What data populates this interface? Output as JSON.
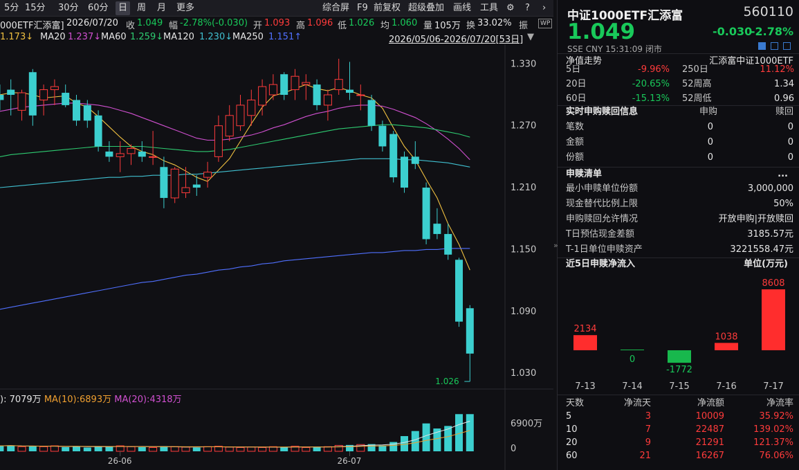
{
  "toolbar": {
    "periods": [
      "5分",
      "15分",
      "30分",
      "60分",
      "日",
      "周",
      "月",
      "更多"
    ],
    "active_period": "日",
    "tools": [
      "综合屏",
      "F9",
      "前复权",
      "超级叠加",
      "画线",
      "工具"
    ],
    "settings_icon": "gear-icon",
    "help_icon": "question-icon",
    "collapse_icon": "chevron-right-icon"
  },
  "info": {
    "name": "000ETF汇添富]",
    "date": "2026/07/20",
    "close_label": "收",
    "close": "1.049",
    "chg_label": "幅",
    "chg": "-2.78%(-0.030)",
    "open_label": "开",
    "open": "1.093",
    "high_label": "高",
    "high": "1.096",
    "low_label": "低",
    "low": "1.026",
    "avg_label": "均",
    "avg": "1.060",
    "vol_label": "量",
    "vol": "105万",
    "turn_label": "换",
    "turn": "33.02%",
    "amp_label": "振",
    "wp_badge": "WP"
  },
  "ma": {
    "ma5_val": "1.173↓",
    "ma20_label": "MA20",
    "ma20_val": "1.237↓",
    "ma60_label": "MA60",
    "ma60_val": "1.259↓",
    "ma120_label": "MA120",
    "ma120_val": "1.230↓",
    "ma250_label": "MA250",
    "ma250_val": "1.151↑",
    "range": "2026/05/06-2026/07/20[53日]",
    "range_dropdown_icon": "triangle-down-icon"
  },
  "price_axis": [
    "1.330",
    "1.270",
    "1.210",
    "1.150",
    "1.090",
    "1.030"
  ],
  "low_marker": "1.026",
  "volume": {
    "ma5_val": "7079万",
    "ma10_label": "MA(10):",
    "ma10_val": "6893万",
    "ma20_label": "MA(20):",
    "ma20_val": "4318万",
    "axis_top": "6900万",
    "axis_zero": "0",
    "dates": [
      "26-06",
      "26-07"
    ],
    "handle_icon": "double-chevron-right-icon"
  },
  "right": {
    "title": "中证1000ETF汇添富",
    "code": "560110",
    "price": "1.049",
    "chg": "-0.030",
    "chg_pct": "-2.78%",
    "market": "SSE  CNY  15:31:09  闭市",
    "nav_label": "净值走势",
    "nav_name": "汇添富中证1000ETF",
    "perf": [
      {
        "p": "5日",
        "v": "-9.96%",
        "p2": "250日",
        "v2": "11.12%"
      },
      {
        "p": "20日",
        "v": "-20.65%",
        "p2": "52周高",
        "v2": "1.34"
      },
      {
        "p": "60日",
        "v": "-15.13%",
        "p2": "52周低",
        "v2": "0.96"
      }
    ],
    "rt_title": "实时申购赎回信息",
    "rt_col1": "申购",
    "rt_col2": "赎回",
    "rt_rows": [
      {
        "k": "笔数",
        "a": "0",
        "b": "0"
      },
      {
        "k": "金额",
        "a": "0",
        "b": "0"
      },
      {
        "k": "份额",
        "a": "0",
        "b": "0"
      }
    ],
    "list_title": "申赎清单",
    "list_more": "...",
    "list_rows": [
      {
        "k": "最小申赎单位份额",
        "v": "3,000,000"
      },
      {
        "k": "现金替代比例上限",
        "v": "50%"
      },
      {
        "k": "申购赎回允许情况",
        "v": "开放申购|开放赎回"
      },
      {
        "k": "T日预估现金差额",
        "v": "3185.57元"
      },
      {
        "k": "T-1日单位申赎资产",
        "v": "3221558.47元"
      }
    ],
    "flow_title": "近5日申赎净流入",
    "flow_unit": "单位(万元)",
    "stats_headers": [
      "天数",
      "净流天",
      "净流额",
      "净流率"
    ],
    "stats": [
      {
        "d": "5",
        "n": "3",
        "amt": "10009",
        "rate": "35.92%"
      },
      {
        "d": "10",
        "n": "7",
        "amt": "22487",
        "rate": "139.02%"
      },
      {
        "d": "20",
        "n": "9",
        "amt": "21291",
        "rate": "121.37%"
      },
      {
        "d": "60",
        "n": "21",
        "amt": "16267",
        "rate": "76.06%"
      }
    ]
  },
  "chart_data": [
    {
      "type": "candlestick",
      "title": "",
      "ylim": [
        1.02,
        1.345
      ],
      "y_ticks": [
        1.33,
        1.27,
        1.21,
        1.15,
        1.09,
        1.03
      ],
      "x_ticks": [
        "26-06",
        "26-07"
      ],
      "candles": [
        {
          "o": 1.3,
          "h": 1.31,
          "l": 1.285,
          "c": 1.295
        },
        {
          "o": 1.305,
          "h": 1.315,
          "l": 1.28,
          "c": 1.3
        },
        {
          "o": 1.285,
          "h": 1.305,
          "l": 1.275,
          "c": 1.302
        },
        {
          "o": 1.322,
          "h": 1.325,
          "l": 1.27,
          "c": 1.28
        },
        {
          "o": 1.295,
          "h": 1.31,
          "l": 1.28,
          "c": 1.305
        },
        {
          "o": 1.305,
          "h": 1.315,
          "l": 1.29,
          "c": 1.308
        },
        {
          "o": 1.302,
          "h": 1.31,
          "l": 1.288,
          "c": 1.29
        },
        {
          "o": 1.295,
          "h": 1.3,
          "l": 1.27,
          "c": 1.275
        },
        {
          "o": 1.29,
          "h": 1.295,
          "l": 1.268,
          "c": 1.275
        },
        {
          "o": 1.28,
          "h": 1.285,
          "l": 1.245,
          "c": 1.25
        },
        {
          "o": 1.245,
          "h": 1.255,
          "l": 1.235,
          "c": 1.24
        },
        {
          "o": 1.24,
          "h": 1.255,
          "l": 1.225,
          "c": 1.243
        },
        {
          "o": 1.243,
          "h": 1.252,
          "l": 1.232,
          "c": 1.248
        },
        {
          "o": 1.245,
          "h": 1.255,
          "l": 1.235,
          "c": 1.24
        },
        {
          "o": 1.24,
          "h": 1.265,
          "l": 1.232,
          "c": 1.24
        },
        {
          "o": 1.23,
          "h": 1.24,
          "l": 1.19,
          "c": 1.2
        },
        {
          "o": 1.2,
          "h": 1.23,
          "l": 1.195,
          "c": 1.228
        },
        {
          "o": 1.205,
          "h": 1.23,
          "l": 1.2,
          "c": 1.21
        },
        {
          "o": 1.213,
          "h": 1.222,
          "l": 1.202,
          "c": 1.21
        },
        {
          "o": 1.22,
          "h": 1.235,
          "l": 1.21,
          "c": 1.225
        },
        {
          "o": 1.24,
          "h": 1.28,
          "l": 1.235,
          "c": 1.27
        },
        {
          "o": 1.26,
          "h": 1.29,
          "l": 1.255,
          "c": 1.28
        },
        {
          "o": 1.27,
          "h": 1.3,
          "l": 1.265,
          "c": 1.29
        },
        {
          "o": 1.28,
          "h": 1.305,
          "l": 1.27,
          "c": 1.295
        },
        {
          "o": 1.29,
          "h": 1.315,
          "l": 1.28,
          "c": 1.308
        },
        {
          "o": 1.3,
          "h": 1.32,
          "l": 1.295,
          "c": 1.31
        },
        {
          "o": 1.32,
          "h": 1.322,
          "l": 1.295,
          "c": 1.3
        },
        {
          "o": 1.305,
          "h": 1.325,
          "l": 1.295,
          "c": 1.318
        },
        {
          "o": 1.31,
          "h": 1.32,
          "l": 1.295,
          "c": 1.312
        },
        {
          "o": 1.31,
          "h": 1.315,
          "l": 1.285,
          "c": 1.29
        },
        {
          "o": 1.29,
          "h": 1.305,
          "l": 1.275,
          "c": 1.3
        },
        {
          "o": 1.305,
          "h": 1.335,
          "l": 1.3,
          "c": 1.315
        },
        {
          "o": 1.305,
          "h": 1.332,
          "l": 1.295,
          "c": 1.302
        },
        {
          "o": 1.3,
          "h": 1.31,
          "l": 1.285,
          "c": 1.3
        },
        {
          "o": 1.295,
          "h": 1.3,
          "l": 1.265,
          "c": 1.27
        },
        {
          "o": 1.27,
          "h": 1.275,
          "l": 1.245,
          "c": 1.25
        },
        {
          "o": 1.262,
          "h": 1.265,
          "l": 1.215,
          "c": 1.22
        },
        {
          "o": 1.24,
          "h": 1.245,
          "l": 1.205,
          "c": 1.21
        },
        {
          "o": 1.24,
          "h": 1.255,
          "l": 1.228,
          "c": 1.233
        },
        {
          "o": 1.21,
          "h": 1.215,
          "l": 1.155,
          "c": 1.16
        },
        {
          "o": 1.175,
          "h": 1.19,
          "l": 1.16,
          "c": 1.165
        },
        {
          "o": 1.165,
          "h": 1.175,
          "l": 1.14,
          "c": 1.145
        },
        {
          "o": 1.14,
          "h": 1.142,
          "l": 1.075,
          "c": 1.08
        },
        {
          "o": 1.093,
          "h": 1.096,
          "l": 1.026,
          "c": 1.049
        }
      ],
      "volume": [
        13,
        14,
        11,
        12,
        11,
        13,
        10,
        12,
        9,
        11,
        12,
        13,
        11,
        10,
        9,
        12,
        11,
        10,
        9,
        11,
        12,
        10,
        9,
        10,
        9,
        11,
        10,
        12,
        9,
        10,
        11,
        14,
        15,
        16,
        17,
        14,
        22,
        36,
        48,
        66,
        54,
        60,
        88,
        88
      ],
      "ma_lines": [
        {
          "name": "MA5",
          "color": "#f0c040",
          "values": [
            1.3,
            1.302,
            1.302,
            1.3,
            1.297,
            1.298,
            1.299,
            1.292,
            1.288,
            1.279,
            1.269,
            1.259,
            1.25,
            1.245,
            1.242,
            1.236,
            1.232,
            1.226,
            1.22,
            1.216,
            1.227,
            1.238,
            1.255,
            1.272,
            1.288,
            1.299,
            1.302,
            1.306,
            1.31,
            1.306,
            1.304,
            1.307,
            1.304,
            1.3,
            1.297,
            1.287,
            1.268,
            1.25,
            1.237,
            1.218,
            1.2,
            1.175,
            1.155,
            1.13
          ]
        },
        {
          "name": "MA20",
          "color": "#d050d0",
          "values": [
            1.284,
            1.286,
            1.288,
            1.289,
            1.29,
            1.291,
            1.292,
            1.292,
            1.291,
            1.29,
            1.288,
            1.285,
            1.282,
            1.278,
            1.274,
            1.27,
            1.266,
            1.262,
            1.258,
            1.256,
            1.256,
            1.257,
            1.259,
            1.261,
            1.264,
            1.268,
            1.271,
            1.275,
            1.279,
            1.282,
            1.284,
            1.287,
            1.289,
            1.29,
            1.29,
            1.289,
            1.286,
            1.282,
            1.278,
            1.272,
            1.265,
            1.257,
            1.248,
            1.237
          ]
        },
        {
          "name": "MA60",
          "color": "#2ecc71",
          "values": [
            1.24,
            1.242,
            1.243,
            1.244,
            1.245,
            1.246,
            1.247,
            1.248,
            1.249,
            1.25,
            1.25,
            1.25,
            1.25,
            1.25,
            1.249,
            1.248,
            1.247,
            1.246,
            1.245,
            1.245,
            1.246,
            1.247,
            1.249,
            1.251,
            1.253,
            1.255,
            1.257,
            1.259,
            1.261,
            1.263,
            1.265,
            1.267,
            1.268,
            1.269,
            1.27,
            1.271,
            1.271,
            1.27,
            1.269,
            1.268,
            1.266,
            1.264,
            1.262,
            1.259
          ]
        },
        {
          "name": "MA120",
          "color": "#40c0d0",
          "values": [
            1.21,
            1.211,
            1.212,
            1.213,
            1.214,
            1.215,
            1.216,
            1.217,
            1.218,
            1.219,
            1.22,
            1.22,
            1.221,
            1.221,
            1.222,
            1.222,
            1.222,
            1.223,
            1.223,
            1.224,
            1.225,
            1.226,
            1.227,
            1.228,
            1.229,
            1.23,
            1.231,
            1.232,
            1.233,
            1.234,
            1.235,
            1.236,
            1.237,
            1.238,
            1.238,
            1.238,
            1.238,
            1.237,
            1.237,
            1.236,
            1.235,
            1.234,
            1.232,
            1.23
          ]
        },
        {
          "name": "MA250",
          "color": "#5070ff",
          "values": [
            1.092,
            1.094,
            1.096,
            1.098,
            1.1,
            1.102,
            1.104,
            1.106,
            1.108,
            1.11,
            1.112,
            1.114,
            1.116,
            1.118,
            1.119,
            1.121,
            1.123,
            1.125,
            1.126,
            1.128,
            1.13,
            1.131,
            1.133,
            1.134,
            1.136,
            1.137,
            1.139,
            1.14,
            1.141,
            1.142,
            1.143,
            1.144,
            1.145,
            1.146,
            1.147,
            1.147,
            1.148,
            1.149,
            1.149,
            1.15,
            1.15,
            1.151,
            1.151,
            1.151
          ]
        }
      ]
    },
    {
      "type": "bar",
      "title": "近5日申赎净流入",
      "ylabel": "单位(万元)",
      "categories": [
        "7-13",
        "7-14",
        "7-15",
        "7-16",
        "7-17"
      ],
      "values": [
        2134,
        0,
        -1772,
        1038,
        8608
      ]
    }
  ]
}
